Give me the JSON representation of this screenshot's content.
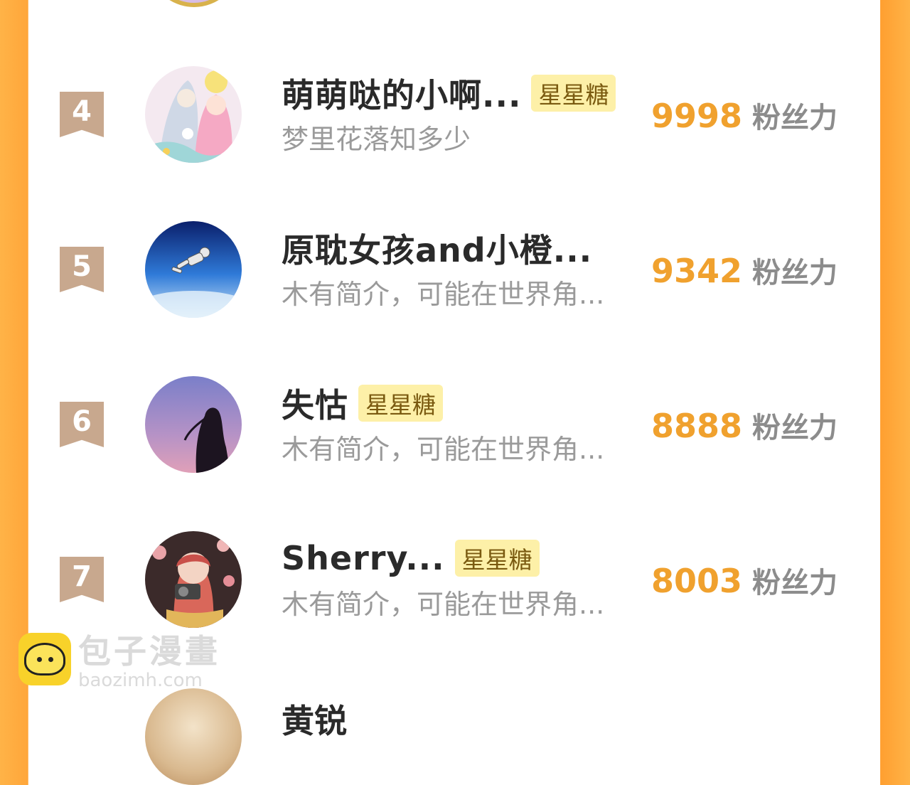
{
  "fans_unit": "粉丝力",
  "rows": [
    {
      "rank": "4",
      "name": "萌萌哒的小啊...",
      "badge": "星星糖",
      "desc": "梦里花落知多少",
      "score": "9998"
    },
    {
      "rank": "5",
      "name": "原耽女孩and小橙...",
      "badge": "",
      "desc": "木有简介，可能在世界角...",
      "score": "9342"
    },
    {
      "rank": "6",
      "name": "失怙",
      "badge": "星星糖",
      "desc": "木有简介，可能在世界角...",
      "score": "8888"
    },
    {
      "rank": "7",
      "name": "Sherry...",
      "badge": "星星糖",
      "desc": "木有简介，可能在世界角...",
      "score": "8003"
    }
  ],
  "next_row": {
    "name": "黄锐"
  },
  "watermark": {
    "title": "包子漫畫",
    "url": "baozimh.com"
  },
  "colors": {
    "accent": "#f0a12e",
    "badge_bg": "#fdf0a8",
    "rank_bg": "#c8a88e",
    "side": "#ffa63a"
  }
}
